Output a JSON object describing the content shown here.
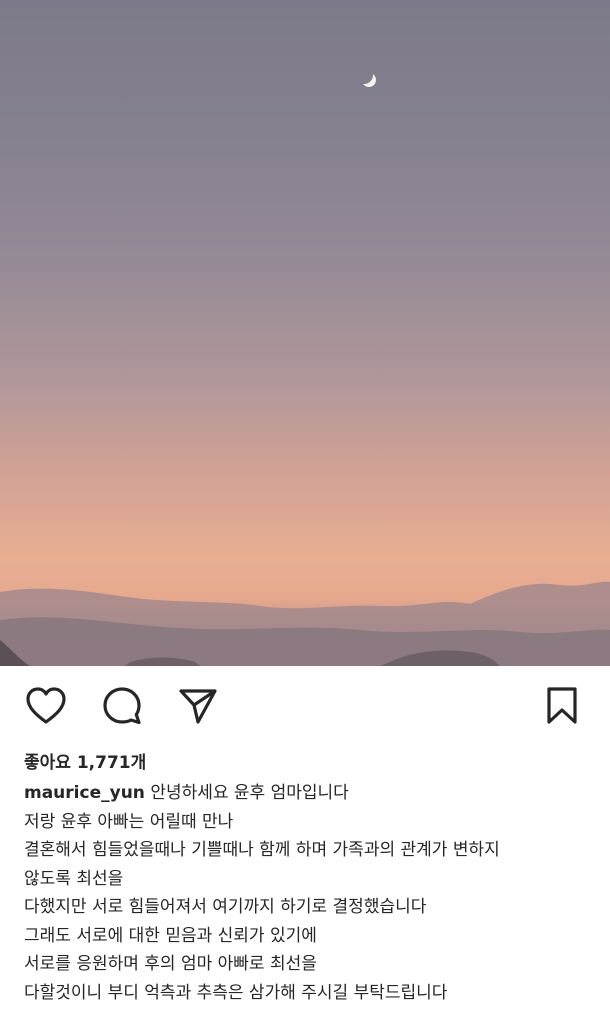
{
  "post": {
    "likes_label": "좋아요",
    "likes_count": "1,771개",
    "username": "maurice_yun",
    "caption_first": "안녕하세요 윤후 엄마입니다",
    "caption_lines": [
      "저랑 윤후 아빠는 어릴때 만나",
      "결혼해서 힘들었을때나 기쁠때나 함께 하며 가족과의 관계가 변하지",
      "않도록 최선을",
      "다했지만 서로 힘들어져서 여기까지 하기로 결정했습니다",
      "그래도 서로에 대한 믿음과 신뢰가 있기에",
      "서로를 응원하며 후의 엄마 아빠로 최선을",
      "다할것이니 부디 억측과 추측은 삼가해 주시길 부탁드립니다"
    ]
  },
  "icons": {
    "like": "heart-icon",
    "comment": "comment-bubble-icon",
    "share": "paper-plane-icon",
    "save": "bookmark-icon"
  },
  "colors": {
    "text": "#262626",
    "background": "#ffffff"
  }
}
